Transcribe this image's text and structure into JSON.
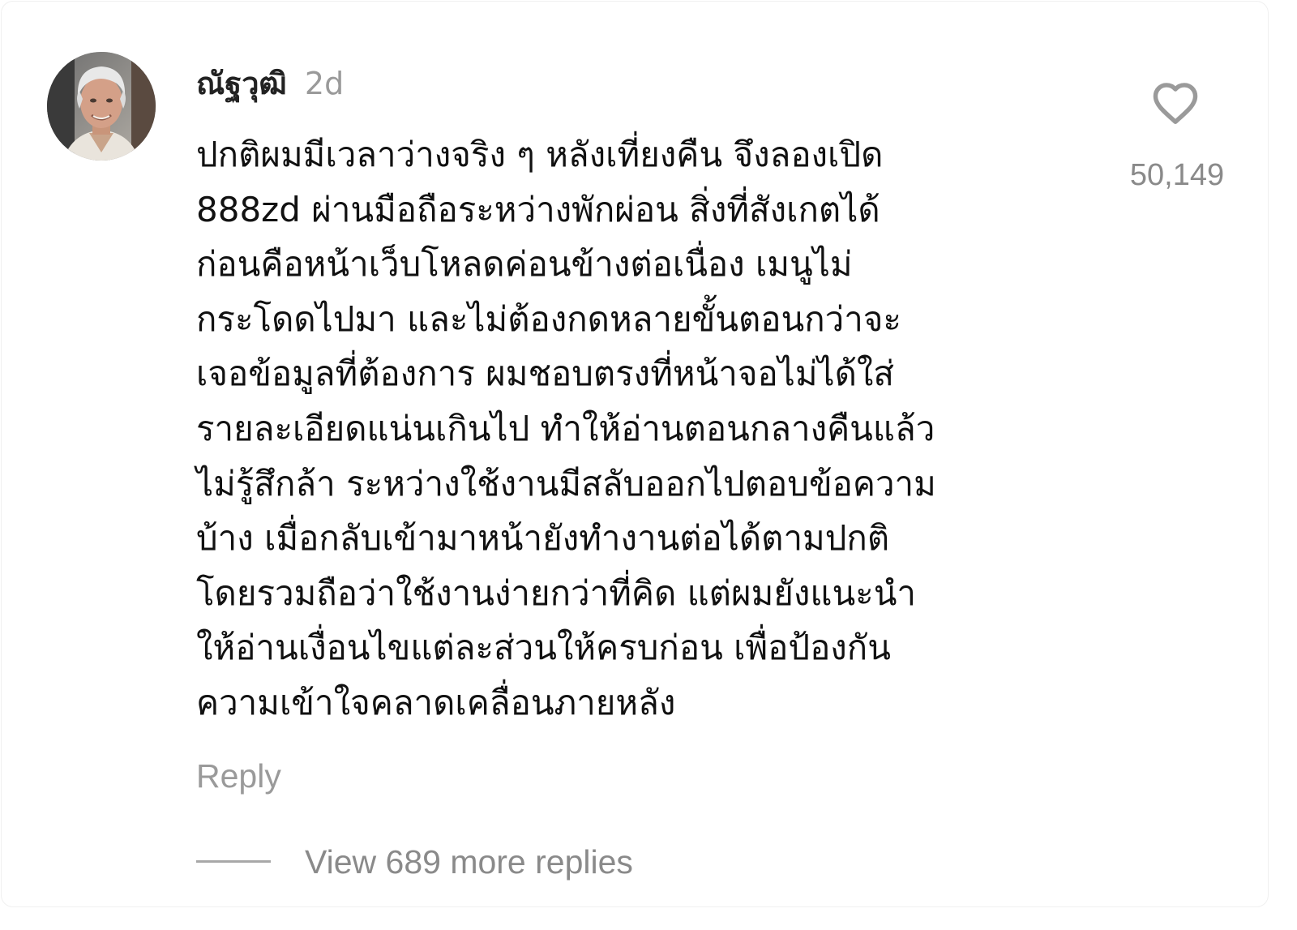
{
  "comment": {
    "username": "ณัฐวุฒิ",
    "timestamp": "2d",
    "body": "ปกติผมมีเวลาว่างจริง ๆ หลังเที่ยงคืน จึงลองเปิด\n888zd ผ่านมือถือระหว่างพักผ่อน สิ่งที่สังเกตได้\nก่อนคือหน้าเว็บโหลดค่อนข้างต่อเนื่อง เมนูไม่\nกระโดดไปมา และไม่ต้องกดหลายขั้นตอนกว่าจะ\nเจอข้อมูลที่ต้องการ ผมชอบตรงที่หน้าจอไม่ได้ใส่\nรายละเอียดแน่นเกินไป ทำให้อ่านตอนกลางคืนแล้ว\nไม่รู้สึกล้า ระหว่างใช้งานมีสลับออกไปตอบข้อความ\nบ้าง เมื่อกลับเข้ามาหน้ายังทำงานต่อได้ตามปกติ\nโดยรวมถือว่าใช้งานง่ายกว่าที่คิด แต่ผมยังแนะนำ\nให้อ่านเงื่อนไขแต่ละส่วนให้ครบก่อน เพื่อป้องกัน\nความเข้าใจคลาดเคลื่อนภายหลัง",
    "like_icon": "heart-outline-icon",
    "like_count": "50,149",
    "reply_label": "Reply",
    "view_replies_label": "View 689 more replies"
  },
  "colors": {
    "username": "#222222",
    "body_text": "#111111",
    "muted": "#9a9a9a",
    "like_icon": "#9a9a9a"
  }
}
